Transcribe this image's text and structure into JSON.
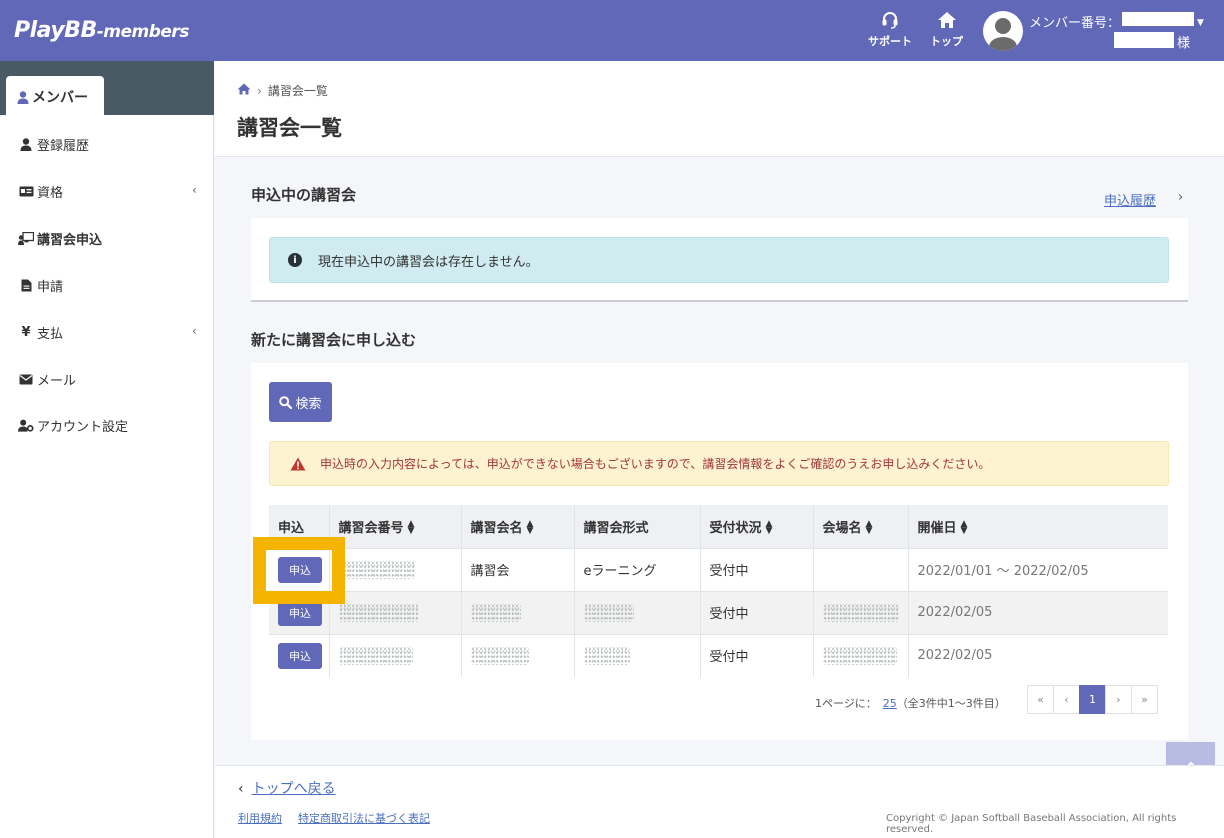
{
  "header": {
    "logo_main": "PlayBB",
    "logo_sub": "-members",
    "support_label": "サポート",
    "top_label": "トップ",
    "member_label": "メンバー番号：",
    "honorific": "様"
  },
  "sidebar": {
    "active_label": "メンバー",
    "items": [
      {
        "label": "登録履歴"
      },
      {
        "label": "資格"
      },
      {
        "label": "講習会申込"
      },
      {
        "label": "申請"
      },
      {
        "label": "支払"
      },
      {
        "label": "メール"
      },
      {
        "label": "アカウント設定"
      }
    ]
  },
  "breadcrumb": {
    "current": "講習会一覧"
  },
  "page_title": "講習会一覧",
  "applied_section": {
    "title": "申込中の講習会",
    "history_link": "申込履歴",
    "info_message": "現在申込中の講習会は存在しません。"
  },
  "new_section": {
    "title": "新たに講習会に申し込む",
    "search_label": "検索",
    "warning_message": "申込時の入力内容によっては、申込ができない場合もございますので、講習会情報をよくご確認のうえお申し込みください。"
  },
  "table": {
    "headers": [
      "申込",
      "講習会番号",
      "講習会名",
      "講習会形式",
      "受付状況",
      "会場名",
      "開催日"
    ],
    "apply_label": "申込",
    "rows": [
      {
        "name": "講習会",
        "format": "eラーニング",
        "status": "受付中",
        "date": "2022/01/01 〜 2022/02/05"
      },
      {
        "name": "",
        "format": "",
        "status": "受付中",
        "date": "2022/02/05"
      },
      {
        "name": "",
        "format": "",
        "status": "受付中",
        "date": "2022/02/05"
      }
    ]
  },
  "pagination": {
    "per_page_label": "1ページに：",
    "per_page_value": "25",
    "range_text": "（全3件中1〜3件目）",
    "first": "«",
    "prev": "‹",
    "current": "1",
    "next": "›",
    "last": "»"
  },
  "footer": {
    "back_link": "トップへ戻る",
    "terms": "利用規約",
    "commerce": "特定商取引法に基づく表記",
    "copyright": "Copyright © Japan Softball Baseball Association, All rights reserved."
  },
  "colors": {
    "brand": "#6168b8",
    "highlight": "#f5b400",
    "info_bg": "#d1ecf1",
    "warning_bg": "#fdf3d0"
  }
}
